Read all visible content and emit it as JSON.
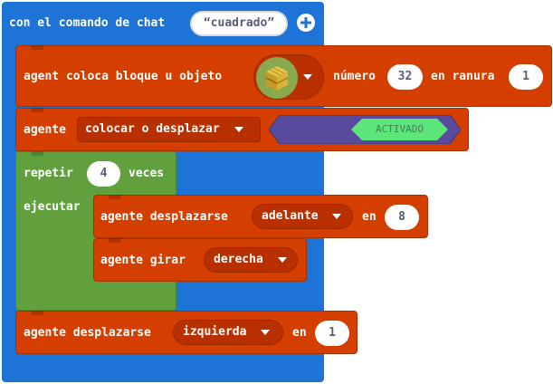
{
  "event": {
    "label": "con el comando de chat",
    "command_value": "“cuadrado”",
    "add_icon": "plus-circle-icon"
  },
  "place_block": {
    "label": "agent coloca bloque u objeto",
    "item_icon": "hay-bale-icon",
    "number_label": "número",
    "number_value": "32",
    "slot_label": "en ranura",
    "slot_value": "1"
  },
  "set_mode": {
    "label": "agente",
    "mode_value": "colocar o desplazar",
    "toggle_value": "ACTIVADO"
  },
  "repeat": {
    "label": "repetir",
    "count": "4",
    "times_label": "veces",
    "do_label": "ejecutar"
  },
  "move_forward": {
    "label": "agente desplazarse",
    "direction": "adelante",
    "by_label": "en",
    "amount": "8"
  },
  "turn": {
    "label": "agente girar",
    "direction": "derecha"
  },
  "move_left": {
    "label": "agente desplazarse",
    "direction": "izquierda",
    "by_label": "en",
    "amount": "1"
  },
  "colors": {
    "event_blue": "#1e74d6",
    "agent_orange": "#d43f00",
    "loop_green": "#62a03d",
    "toggle_purple": "#5a4a9e",
    "toggle_green": "#5ce67a"
  }
}
